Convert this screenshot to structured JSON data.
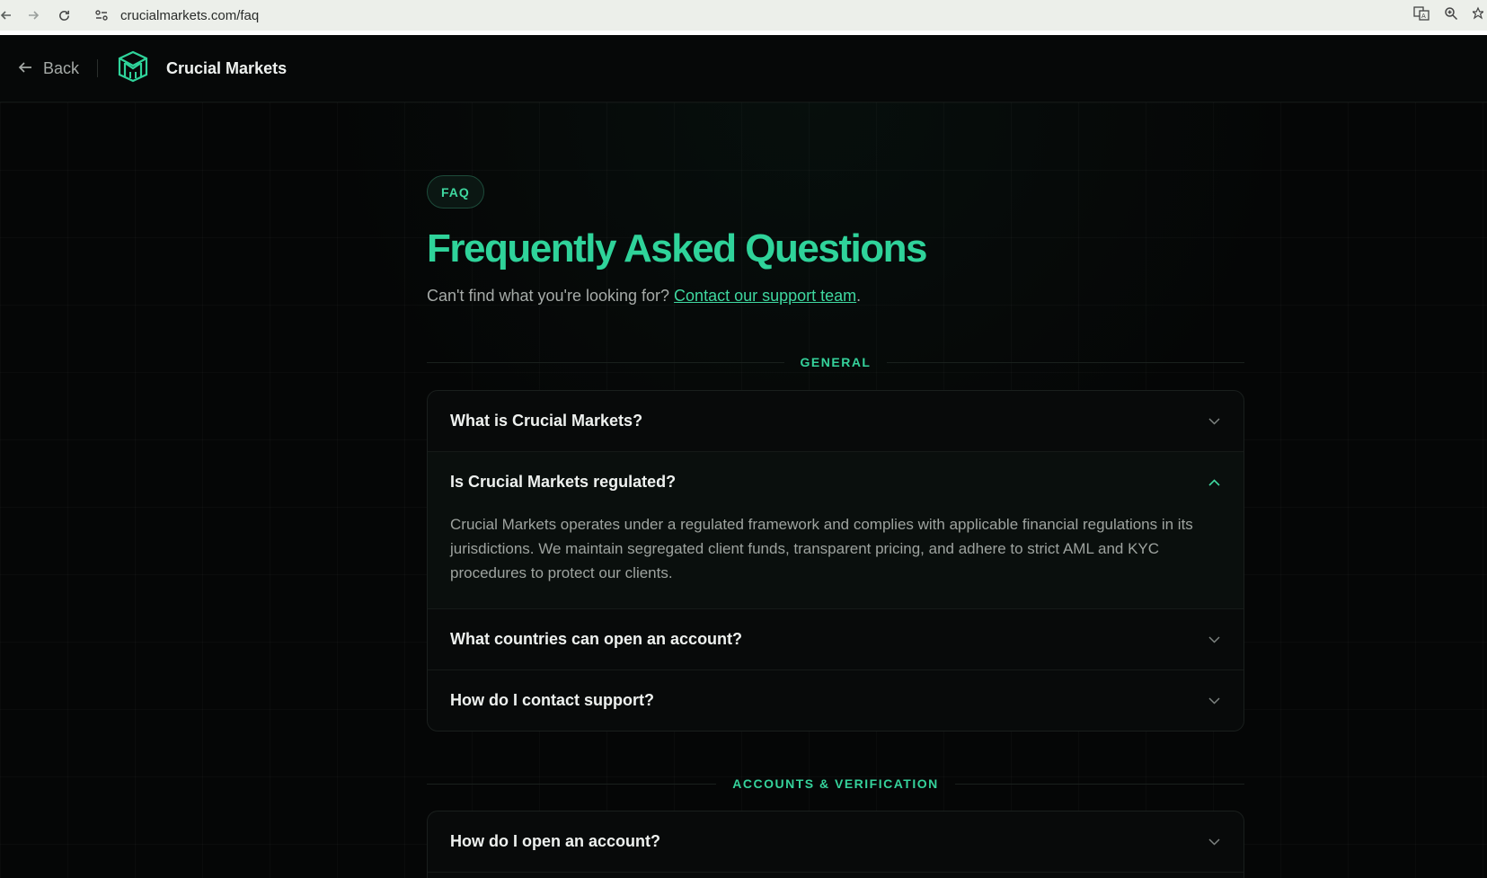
{
  "browser": {
    "url": "crucialmarkets.com/faq"
  },
  "header": {
    "back_label": "Back",
    "brand_name": "Crucial Markets"
  },
  "hero": {
    "pill": "FAQ",
    "title": "Frequently Asked Questions",
    "subtitle_prefix": "Can't find what you're looking for?",
    "subtitle_link": "Contact our support team",
    "subtitle_suffix": "."
  },
  "sections": [
    {
      "label": "GENERAL",
      "items": [
        {
          "question": "What is Crucial Markets?",
          "open": false
        },
        {
          "question": "Is Crucial Markets regulated?",
          "open": true,
          "answer": "Crucial Markets operates under a regulated framework and complies with applicable financial regulations in its jurisdictions. We maintain segregated client funds, transparent pricing, and adhere to strict AML and KYC procedures to protect our clients."
        },
        {
          "question": "What countries can open an account?",
          "open": false
        },
        {
          "question": "How do I contact support?",
          "open": false
        }
      ]
    },
    {
      "label": "ACCOUNTS & VERIFICATION",
      "items": [
        {
          "question": "How do I open an account?",
          "open": false
        }
      ]
    }
  ],
  "colors": {
    "accent": "#2fd39a",
    "background": "#050606"
  }
}
